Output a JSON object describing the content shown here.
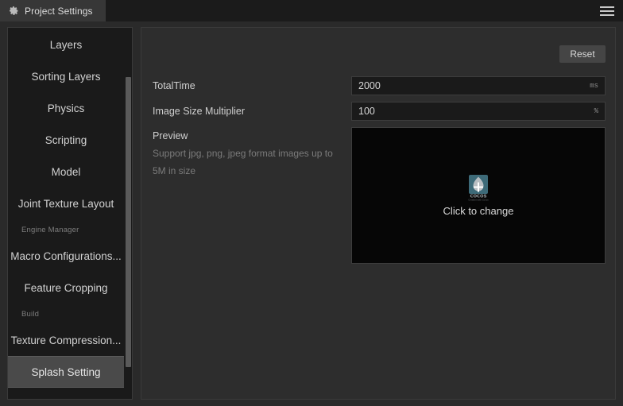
{
  "window": {
    "tab_label": "Project Settings",
    "tab_icon": "gear-icon",
    "menu_icon": "hamburger-menu-icon"
  },
  "sidebar": {
    "items": [
      {
        "type": "item",
        "label": "Layers",
        "selected": false
      },
      {
        "type": "item",
        "label": "Sorting Layers",
        "selected": false
      },
      {
        "type": "item",
        "label": "Physics",
        "selected": false
      },
      {
        "type": "item",
        "label": "Scripting",
        "selected": false
      },
      {
        "type": "item",
        "label": "Model",
        "selected": false
      },
      {
        "type": "item",
        "label": "Joint Texture Layout",
        "selected": false
      },
      {
        "type": "group",
        "label": "Engine Manager"
      },
      {
        "type": "item",
        "label": "Macro Configurations...",
        "selected": false
      },
      {
        "type": "item",
        "label": "Feature Cropping",
        "selected": false
      },
      {
        "type": "group",
        "label": "Build"
      },
      {
        "type": "item",
        "label": "Texture Compression...",
        "selected": false
      },
      {
        "type": "item",
        "label": "Splash Setting",
        "selected": true
      }
    ]
  },
  "main": {
    "reset_label": "Reset",
    "fields": [
      {
        "label": "TotalTime",
        "value": "2000",
        "unit": "ms"
      },
      {
        "label": "Image Size Multiplier",
        "value": "100",
        "unit": "%"
      }
    ],
    "preview": {
      "title": "Preview",
      "hint": "Support jpg, png, jpeg format images up to 5M in size",
      "dropzone_text": "Click to change",
      "dropzone_icon": "cocos-add-image-icon"
    }
  },
  "colors": {
    "window_bg": "#2a2a2a",
    "tabbar_bg": "#1b1b1b",
    "tab_active_bg": "#373737",
    "sidebar_bg": "#1a1a1a",
    "panel_bg": "#2d2d2d",
    "selected_item_bg": "#4a4a4a",
    "input_bg": "#1a1a1a",
    "dropzone_bg": "#060606",
    "text_primary": "#d2d2d2",
    "text_muted": "#7b7b7b",
    "button_bg": "#454545"
  }
}
